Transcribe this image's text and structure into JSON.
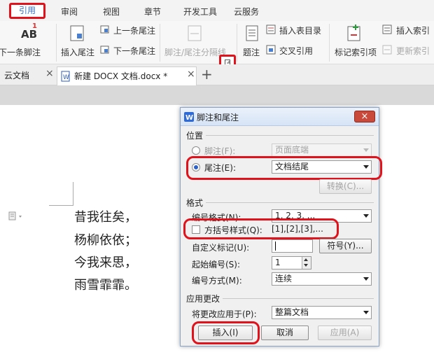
{
  "ribbon": {
    "tabs": [
      "引用",
      "审阅",
      "视图",
      "章节",
      "开发工具",
      "云服务"
    ],
    "buttons": {
      "next_footnote_left": "下一条脚注",
      "insert_endnote": "插入尾注",
      "prev_endnote": "上一条尾注",
      "next_endnote": "下一条尾注",
      "note_separator": "脚注/尾注分隔线",
      "caption": "题注",
      "insert_table_of_figures": "插入表目录",
      "cross_reference": "交叉引用",
      "mark_index_entry": "标记索引项",
      "insert_index": "插入索引",
      "update_index": "更新索引"
    },
    "footnote_icon_text": "AB",
    "footnote_icon_sup": "1"
  },
  "doctabs": {
    "cloud": "云文档",
    "close": "×",
    "active_doc": "新建 DOCX 文档.docx *",
    "add": "+"
  },
  "poem": [
    "昔我往矣，",
    "杨柳依依；",
    "今我来思，",
    "雨雪霏霏。"
  ],
  "dialog": {
    "title": "脚注和尾注",
    "close": "×",
    "section_location": "位置",
    "footnote_label": "脚注(F):",
    "footnote_value": "页面底端",
    "endnote_label": "尾注(E):",
    "endnote_value": "文档结尾",
    "convert_button": "转换(C)...",
    "section_format": "格式",
    "number_format_label": "编号格式(N):",
    "number_format_value": "1, 2, 3, ...",
    "bracket_style_label": "方括号样式(Q):",
    "bracket_style_example": "[1],[2],[3],...",
    "custom_mark_label": "自定义标记(U):",
    "symbol_button": "符号(Y)...",
    "start_number_label": "起始编号(S):",
    "start_number_value": "1",
    "numbering_label": "编号方式(M):",
    "numbering_value": "连续",
    "section_apply": "应用更改",
    "apply_to_label": "将更改应用于(P):",
    "apply_to_value": "整篇文档",
    "insert_button": "插入(I)",
    "cancel_button": "取消",
    "apply_button": "应用(A)"
  },
  "colors": {
    "highlight": "#e0121b",
    "accent": "#3a6fc0"
  }
}
